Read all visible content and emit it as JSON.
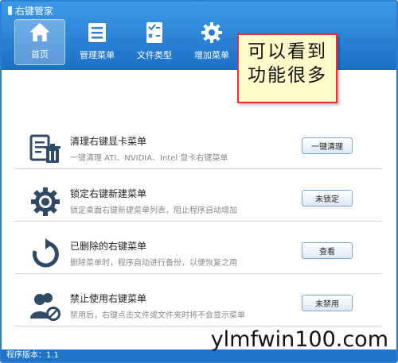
{
  "app": {
    "title": "右键管家"
  },
  "nav": [
    {
      "label": "首页",
      "icon": "home-icon",
      "active": true
    },
    {
      "label": "管理菜单",
      "icon": "menu-list-icon",
      "active": false
    },
    {
      "label": "文件类型",
      "icon": "file-type-icon",
      "active": false
    },
    {
      "label": "增加菜单",
      "icon": "gear-icon",
      "active": false
    }
  ],
  "callout": {
    "line1": "可以看到",
    "line2": "功能很多"
  },
  "items": [
    {
      "title": "清理右键显卡菜单",
      "desc": "一键清理 ATI、NVIDIA、Intel 显卡右键菜单",
      "button": "一键清理",
      "icon": "clean-icon"
    },
    {
      "title": "锁定右键新建菜单",
      "desc": "锁定桌面右键新建菜单列表，阻止程序自动增加",
      "button": "未锁定",
      "icon": "lock-gear-icon"
    },
    {
      "title": "已删除的右键菜单",
      "desc": "删除菜单时，程序自动进行备份，以便恢复之用",
      "button": "查看",
      "icon": "restore-icon"
    },
    {
      "title": "禁止使用右键菜单",
      "desc": "禁用后，右键点击文件或文件夹时将不会显示菜单",
      "button": "未禁用",
      "icon": "user-disable-icon"
    }
  ],
  "footer": {
    "version": "程序版本：1.1"
  },
  "watermark": "ylmfwin100.com",
  "colors": {
    "accent": "#1f73c9",
    "callout_border": "#dd3333",
    "callout_bg": "#fffac9"
  }
}
